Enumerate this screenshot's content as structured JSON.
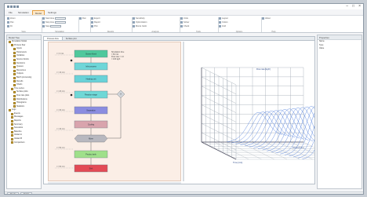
{
  "window": {
    "title": "",
    "controls": [
      "–",
      "□",
      "×"
    ]
  },
  "ribbon_tabs": [
    "File",
    "Simulation",
    "Model",
    "Settings"
  ],
  "ribbon_active_tab": 2,
  "ribbon": {
    "groups": [
      {
        "label": "View",
        "rows": [
          "Zoom",
          "Pan",
          "Fit"
        ]
      },
      {
        "label": "Simulation",
        "rows": [
          "Start time",
          "Stop time",
          "Step"
        ]
      },
      {
        "label": "",
        "rows": [
          "Run"
        ]
      },
      {
        "label": "Results",
        "rows": [
          "Export",
          "Report",
          "Plot"
        ]
      },
      {
        "label": "Analysis",
        "rows": [
          "Sensitivity",
          "Optimization",
          "Monte Carlo"
        ]
      },
      {
        "label": "Tools",
        "rows": [
          "Units",
          "Solver",
          "Check"
        ]
      },
      {
        "label": "Options",
        "rows": [
          "Layout",
          "Colors",
          "Grid"
        ]
      },
      {
        "label": "Help",
        "rows": [
          "About"
        ]
      }
    ]
  },
  "tree": {
    "header": "Model Tree",
    "items": [
      {
        "label": "Simulation Model",
        "level": 0
      },
      {
        "label": "Process flow",
        "level": 1
      },
      {
        "label": "Inputs",
        "level": 2
      },
      {
        "label": "Parameters",
        "level": 2
      },
      {
        "label": "Variables",
        "level": 2
      },
      {
        "label": "Source blocks",
        "level": 2
      },
      {
        "label": "Decisions",
        "level": 2
      },
      {
        "label": "Queues",
        "level": 2
      },
      {
        "label": "Resources",
        "level": 2
      },
      {
        "label": "Outputs",
        "level": 2
      },
      {
        "label": "Batch processing",
        "level": 2
      },
      {
        "label": "Results",
        "level": 2
      },
      {
        "label": "Charts",
        "level": 2
      },
      {
        "label": "Time series",
        "level": 1
      },
      {
        "label": "Surface plots",
        "level": 2
      },
      {
        "label": "Flow rate plots",
        "level": 2
      },
      {
        "label": "Distributions",
        "level": 2
      },
      {
        "label": "Histograms",
        "level": 2
      },
      {
        "label": "Statistics",
        "level": 2
      },
      {
        "label": "Logs",
        "level": 0
      },
      {
        "label": "Events",
        "level": 1
      },
      {
        "label": "Messages",
        "level": 1
      },
      {
        "label": "Reports",
        "level": 1
      },
      {
        "label": "Summary",
        "level": 1
      },
      {
        "label": "Scenarios",
        "level": 1
      },
      {
        "label": "Baseline",
        "level": 1
      },
      {
        "label": "Variant A",
        "level": 1
      },
      {
        "label": "Variant B",
        "level": 1
      },
      {
        "label": "Comparison",
        "level": 1
      }
    ]
  },
  "doc_tabs": [
    "Process flow",
    "Surface plot"
  ],
  "doc_active_tab": 0,
  "flow": {
    "stages": [
      "t = 0 min",
      "t = 10 min",
      "t = 20 min",
      "t = 30 min",
      "t = 40 min",
      "t = 50 min",
      "t = 60 min"
    ],
    "blocks": [
      {
        "label": "Source block",
        "color": "#4fc89c"
      },
      {
        "label": "Inlet process",
        "color": "#6fd6d8"
      },
      {
        "label": "Heating unit",
        "color": "#69d2d8"
      },
      {
        "label": "Reaction stage",
        "color": "#6fd8d6"
      },
      {
        "label": "Separation",
        "color": "#8b8de0"
      },
      {
        "label": "Cooling",
        "color": "#d9a4ad"
      },
      {
        "label": "Mixer",
        "color": "#b8b8bf"
      },
      {
        "label": "Product tank",
        "color": "#9fe08a"
      },
      {
        "label": "Sink",
        "color": "#e34a55"
      }
    ],
    "note": [
      "Simulation time",
      "= 60 min",
      "Flow rate = 1.0",
      "= 100 kg/h"
    ],
    "decision": "?"
  },
  "plot3d": {
    "labels": {
      "z": "Flow rate [kg/h]",
      "x": "Time [min]",
      "y": "Distance [m]"
    },
    "curve_color": "#3a6fd8"
  },
  "props": {
    "header": "Properties",
    "rows": [
      "Name",
      "Type",
      "Value"
    ]
  },
  "status": [
    "Ready",
    "Model"
  ]
}
